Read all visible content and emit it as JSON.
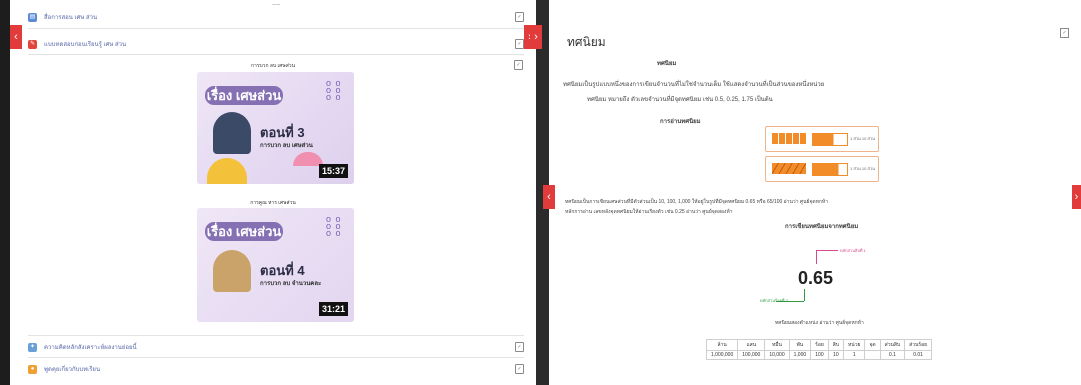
{
  "left_panel": {
    "items": [
      {
        "label": "สื่อการสอน เศษ ส่วน",
        "icon": "document-icon",
        "color": "#5b8bd6"
      },
      {
        "label": "แบบทดสอบก่อนเรียนรู้ เศษ ส่วน",
        "icon": "quiz-icon",
        "color": "#e2453c"
      }
    ],
    "videos": [
      {
        "caption": "การบวก ลบ เศษส่วน",
        "title": "เรื่อง เศษส่วน",
        "episode": "ตอนที่ 3",
        "subtitle": "การบวก ลบ เศษส่วน",
        "duration": "15:37"
      },
      {
        "caption": "การคูณ หาร เศษส่วน",
        "title": "เรื่อง เศษส่วน",
        "episode": "ตอนที่ 4",
        "subtitle": "การบวก ลบ จำนวนคละ",
        "duration": "31:21"
      }
    ],
    "footer_items": [
      {
        "label": "ความคิดหลักสังเคราะห์ผลงานย่อยนี้",
        "icon": "lightbulb-icon",
        "color": "#6aa0d8"
      },
      {
        "label": "พูดคุยเกี่ยวกับบทเรียน",
        "icon": "chat-icon",
        "color": "#f0a030"
      }
    ],
    "top_marker": "~~"
  },
  "right_panel": {
    "title": "ทศนิยม",
    "section_heading": "ทศนิยม",
    "intro_line1": "ทศนิยมเป็นรูปแบบหนึ่งของการเขียนจำนวนที่ไม่ใช่จำนวนเต็ม ใช้แสดงจำนวนที่เป็นส่วนของหนึ่งหน่วย",
    "intro_line2": "ทศนิยม หมายถึง ตัวเลขจำนวนที่มีจุดทศนิยม เช่น 0.5, 0.25, 1.75 เป็นต้น",
    "examples_heading": "การอ่านทศนิยม",
    "example1_note": "1 ส่วน 10 ส่วน",
    "example2_note": "1 ส่วน 10 ส่วน",
    "body_text1": "ทศนิยมเป็นการเขียนเศษส่วนที่มีตัวส่วนเป็น 10, 100, 1,000 ให้อยู่ในรูปที่มีจุดทศนิยม 0.65 หรือ 65/100 อ่านว่า ศูนย์จุดหกห้า",
    "body_text2": "หลักการอ่าน เลขหลังจุดทศนิยมให้อ่านเรียงตัว เช่น 0.25 อ่านว่า ศูนย์จุดสองห้า",
    "place_heading": "การเขียนทศนิยมจากทศนิยม",
    "decimal_value": "0.65",
    "top_label": "หลักส่วนสิบที่ 1",
    "bottom_label": "หลักส่วนร้อยที่ 2",
    "decimal_caption": "ทศนิยมสองตำแหน่ง อ่านว่า ศูนย์จุดหกห้า",
    "table_headers": [
      "ล้าน",
      "แสน",
      "หมื่น",
      "พัน",
      "ร้อย",
      "สิบ",
      "หน่วย",
      "จุด",
      "ส่วนสิบ",
      "ส่วนร้อย"
    ],
    "table_values": [
      "1,000,000",
      "100,000",
      "10,000",
      "1,000",
      "100",
      "10",
      "1",
      "",
      "0.1",
      "0.01"
    ]
  },
  "colors": {
    "accent": "#e23b3b",
    "orange": "#f28c28",
    "purple": "#8670b4",
    "green": "#2f9a3e"
  }
}
